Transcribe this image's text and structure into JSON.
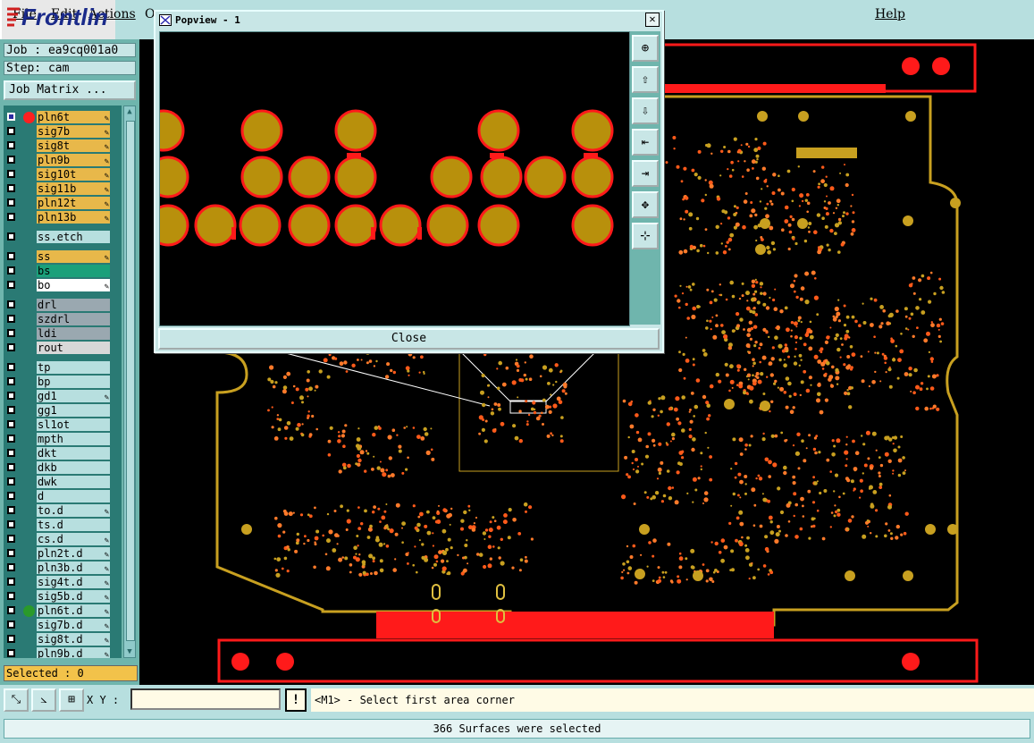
{
  "menu": {
    "file": "File",
    "edit": "Edit",
    "actions": "Actions",
    "options": "O",
    "help": "Help"
  },
  "brand": {
    "name": "Frontlin",
    "color": "#1a2a8a"
  },
  "job": {
    "job_label": "Job : ea9cq001a0",
    "step_label": "Step: cam",
    "matrix_button": "Job Matrix ..."
  },
  "layers": [
    {
      "name": "pln6t",
      "color": "#e8b84a",
      "dot": "#ff2020",
      "icon": "pencil-icon",
      "active": true
    },
    {
      "name": "sig7b",
      "color": "#e8b84a",
      "icon": "pencil-icon"
    },
    {
      "name": "sig8t",
      "color": "#e8b84a",
      "icon": "pencil-icon"
    },
    {
      "name": "pln9b",
      "color": "#e8b84a",
      "icon": "pencil-icon"
    },
    {
      "name": "sig10t",
      "color": "#e8b84a",
      "icon": "pencil-icon"
    },
    {
      "name": "sig11b",
      "color": "#e8b84a",
      "icon": "pencil-icon"
    },
    {
      "name": "pln12t",
      "color": "#e8b84a",
      "icon": "pencil-icon"
    },
    {
      "name": "pln13b",
      "color": "#e8b84a",
      "icon": "pencil-icon"
    },
    {
      "name": "ss.etch",
      "color": "#b7dfdf"
    },
    {
      "name": "ss",
      "color": "#e8b84a",
      "icon": "pencil-icon"
    },
    {
      "name": "bs",
      "color": "#1aa07a"
    },
    {
      "name": "bo",
      "color": "#ffffff",
      "icon": "pencil-icon"
    },
    {
      "name": "drl",
      "color": "#9aa8b0"
    },
    {
      "name": "szdrl",
      "color": "#9aa8b0"
    },
    {
      "name": "ldi",
      "color": "#9aa8b0"
    },
    {
      "name": "rout",
      "color": "#d8d8d8"
    },
    {
      "name": "tp",
      "color": "#b7dfdf"
    },
    {
      "name": "bp",
      "color": "#b7dfdf"
    },
    {
      "name": "gd1",
      "color": "#b7dfdf",
      "icon": "pencil-icon"
    },
    {
      "name": "gg1",
      "color": "#b7dfdf"
    },
    {
      "name": "sl1ot",
      "color": "#b7dfdf"
    },
    {
      "name": "mpth",
      "color": "#b7dfdf"
    },
    {
      "name": "dkt",
      "color": "#b7dfdf"
    },
    {
      "name": "dkb",
      "color": "#b7dfdf"
    },
    {
      "name": "dwk",
      "color": "#b7dfdf"
    },
    {
      "name": "d",
      "color": "#b7dfdf"
    },
    {
      "name": "to.d",
      "color": "#b7dfdf",
      "icon": "pencil-icon"
    },
    {
      "name": "ts.d",
      "color": "#b7dfdf"
    },
    {
      "name": "cs.d",
      "color": "#b7dfdf",
      "icon": "pencil-icon"
    },
    {
      "name": "pln2t.d",
      "color": "#b7dfdf",
      "icon": "pencil-icon"
    },
    {
      "name": "pln3b.d",
      "color": "#b7dfdf",
      "icon": "pencil-icon"
    },
    {
      "name": "sig4t.d",
      "color": "#b7dfdf",
      "icon": "pencil-icon"
    },
    {
      "name": "sig5b.d",
      "color": "#b7dfdf",
      "icon": "pencil-icon"
    },
    {
      "name": "pln6t.d",
      "color": "#b7dfdf",
      "dot": "#2a9a2a",
      "icon": "pencil-icon"
    },
    {
      "name": "sig7b.d",
      "color": "#b7dfdf",
      "icon": "pencil-icon"
    },
    {
      "name": "sig8t.d",
      "color": "#b7dfdf",
      "icon": "pencil-icon"
    },
    {
      "name": "pln9b.d",
      "color": "#b7dfdf",
      "icon": "pencil-icon"
    }
  ],
  "selected_label": "Selected : 0",
  "popview": {
    "title": "Popview - 1",
    "close_button": "Close",
    "tool_icons": [
      "zoom-in-icon",
      "zoom-home-icon",
      "zoom-out-icon",
      "pan-left-icon",
      "pan-right-icon",
      "fit-icon",
      "center-icon"
    ]
  },
  "command": {
    "xy_label": "X Y :",
    "xy_value": "",
    "warning_icon": "!",
    "prompt": "<M1> - Select first area corner"
  },
  "status": {
    "message": "366 Surfaces were selected"
  },
  "colors": {
    "copper": "#b8900c",
    "pad_outline": "#ff1a1a",
    "board_outline": "#c8a020",
    "canvas": "#000000"
  }
}
